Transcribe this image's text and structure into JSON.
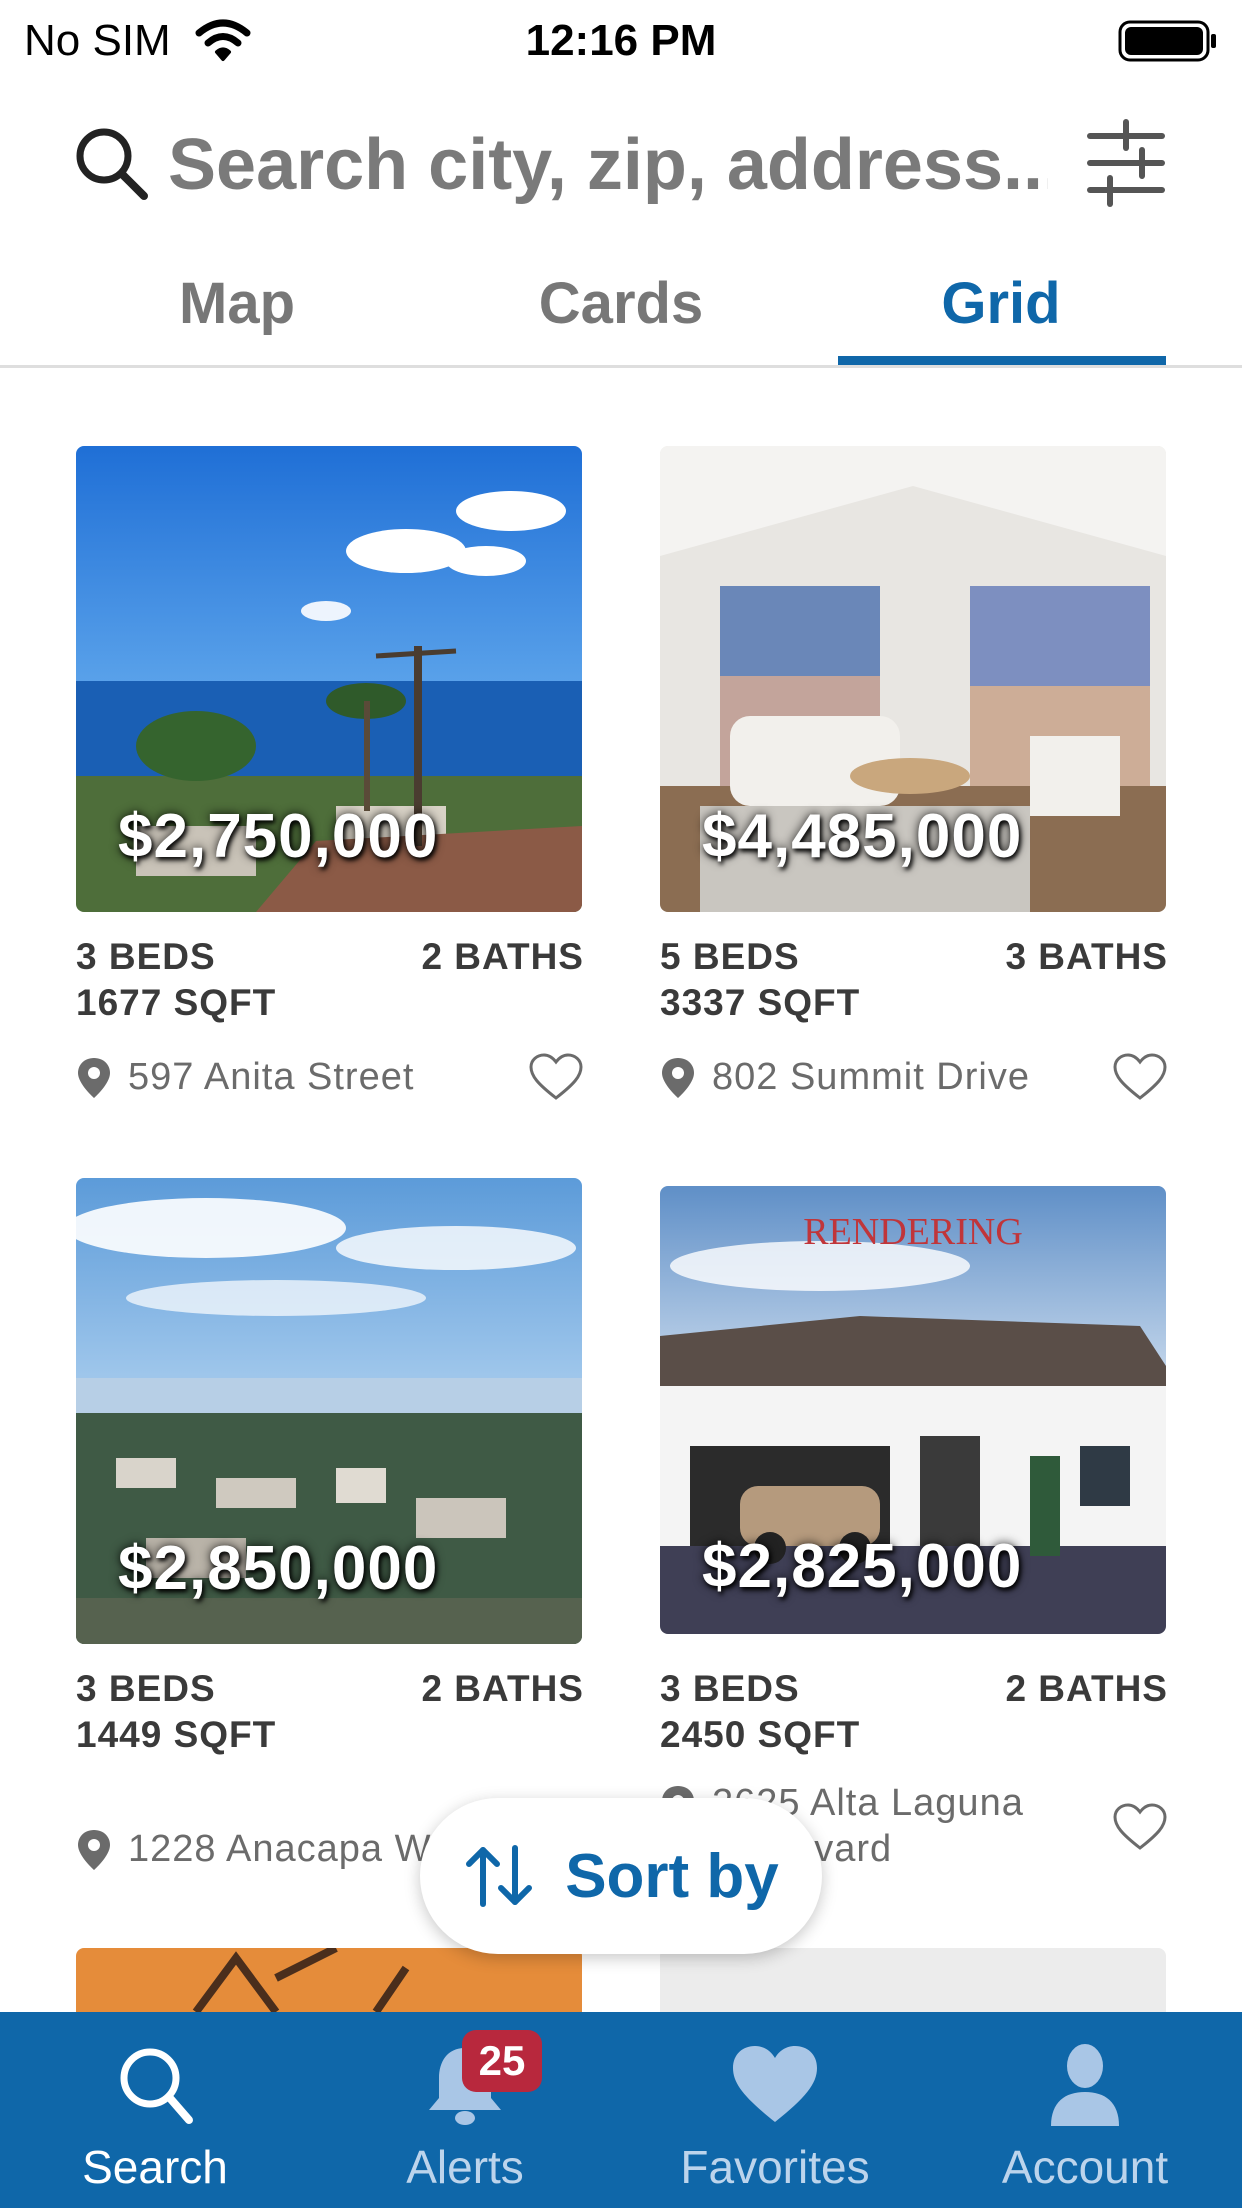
{
  "status_bar": {
    "carrier": "No SIM",
    "time": "12:16 PM"
  },
  "search": {
    "placeholder": "Search city, zip, address..."
  },
  "tabs": [
    {
      "label": "Map",
      "active": false
    },
    {
      "label": "Cards",
      "active": false
    },
    {
      "label": "Grid",
      "active": true
    }
  ],
  "listings": [
    {
      "price": "$2,750,000",
      "beds": "3 BEDS",
      "baths": "2 BATHS",
      "sqft": "1677 SQFT",
      "address": "597 Anita Street",
      "favorite": false,
      "photo": "ocean view with palm trees"
    },
    {
      "price": "$4,485,000",
      "beds": "5 BEDS",
      "baths": "3 BATHS",
      "sqft": "3337 SQFT",
      "address": "802 Summit Drive",
      "favorite": false,
      "photo": "living room interior"
    },
    {
      "price": "$2,850,000",
      "beds": "3 BEDS",
      "baths": "2 BATHS",
      "sqft": "1449 SQFT",
      "address": "1228 Anacapa W",
      "favorite": false,
      "photo": "coastal town view"
    },
    {
      "price": "$2,825,000",
      "beds": "3 BEDS",
      "baths": "2 BATHS",
      "sqft": "2450 SQFT",
      "address": "2625 Alta Laguna Boulevard",
      "favorite": false,
      "photo": "house exterior rendering",
      "photo_caption": "RENDERING"
    }
  ],
  "sort": {
    "label": "Sort by"
  },
  "bottom_nav": {
    "items": [
      {
        "label": "Search",
        "icon": "search-icon",
        "active": true
      },
      {
        "label": "Alerts",
        "icon": "bell-icon",
        "active": false,
        "badge": "25"
      },
      {
        "label": "Favorites",
        "icon": "heart-icon",
        "active": false
      },
      {
        "label": "Account",
        "icon": "person-icon",
        "active": false
      }
    ]
  },
  "colors": {
    "brand": "#0f67a9",
    "badge": "#b8283d"
  }
}
